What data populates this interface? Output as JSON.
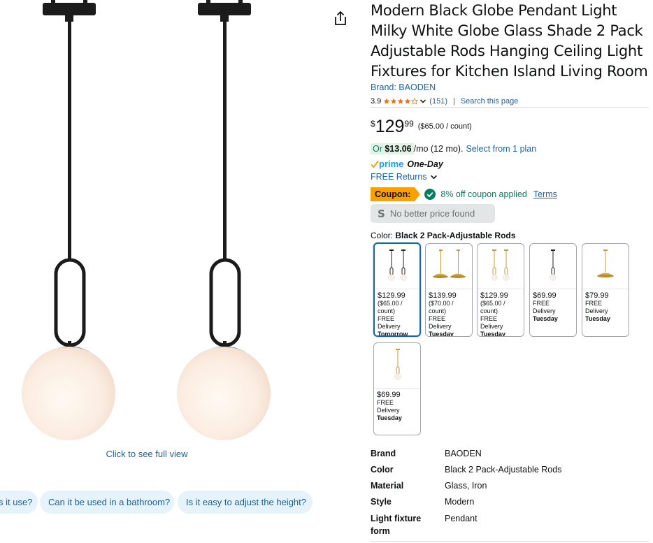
{
  "product": {
    "title": "Modern Black Globe Pendant Light Milky White Globe Glass Shade 2 Pack Adjustable Rods Hanging Ceiling Light Fixtures for Kitchen Island Living Room",
    "brand_link": "Brand: BAODEN",
    "rating": "3.9",
    "rating_value": 3.9,
    "review_count": "(151)",
    "search_page": "Search this page",
    "price_symbol": "$",
    "price_whole": "129",
    "price_fraction": "99",
    "unit_price": "($65.00 / count)",
    "monthly_prefix": "Or ",
    "monthly_amount": "$13.06",
    "monthly_suffix": "/mo (12 mo).",
    "select_plan": "Select from 1 plan",
    "prime_label": "prime",
    "prime_speed": "One-Day",
    "returns": "FREE Returns",
    "coupon_label": "Coupon:",
    "coupon_text": "8% off coupon applied",
    "terms": "Terms",
    "no_better_icon": "S",
    "no_better": "No better price found",
    "color_prefix": "Color: ",
    "color_value": "Black 2 Pack-Adjustable Rods"
  },
  "gallery": {
    "full_view": "Click to see full view"
  },
  "chips": [
    "s it use?",
    "Can it be used in a bathroom?",
    "Is it easy to adjust the height?"
  ],
  "swatches": [
    {
      "price": "$129.99",
      "unit": "($65.00 / count)",
      "delivery": "FREE Delivery",
      "day": "Tomorrow",
      "selected": true
    },
    {
      "price": "$139.99",
      "unit": "($70.00 / count)",
      "delivery": "FREE Delivery",
      "day": "Tuesday",
      "selected": false
    },
    {
      "price": "$129.99",
      "unit": "($65.00 / count)",
      "delivery": "FREE Delivery",
      "day": "Tuesday",
      "selected": false
    },
    {
      "price": "$69.99",
      "unit": "",
      "delivery": "FREE Delivery",
      "day": "Tuesday",
      "selected": false
    },
    {
      "price": "$79.99",
      "unit": "",
      "delivery": "FREE Delivery",
      "day": "Tuesday",
      "selected": false
    },
    {
      "price": "$69.99",
      "unit": "",
      "delivery": "FREE Delivery",
      "day": "Tuesday",
      "selected": false
    }
  ],
  "specs": [
    {
      "key": "Brand",
      "value": "BAODEN"
    },
    {
      "key": "Color",
      "value": "Black 2 Pack-Adjustable Rods"
    },
    {
      "key": "Material",
      "value": "Glass, Iron"
    },
    {
      "key": "Style",
      "value": "Modern"
    },
    {
      "key": "Light fixture form",
      "value": "Pendant"
    }
  ],
  "colors": {
    "link": "#2162a1",
    "coupon": "#f7a000",
    "success": "#067d62",
    "star": "#de7921",
    "prime": "#1a98ff"
  },
  "icons": [
    "share-icon",
    "star-icon",
    "chevron-down-icon",
    "prime-check-icon",
    "checkmark-circle-icon"
  ]
}
